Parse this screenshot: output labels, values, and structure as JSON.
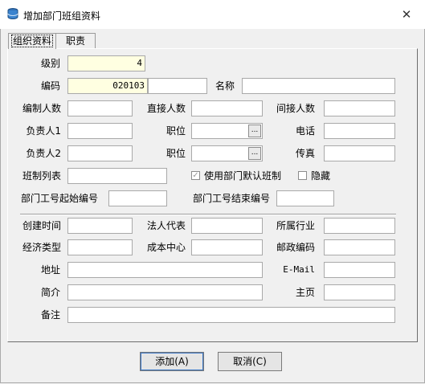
{
  "window": {
    "title": "增加部门班组资料",
    "close_symbol": "✕",
    "app_icon": "database-icon"
  },
  "tabs": [
    {
      "label": "组织资料"
    },
    {
      "label": "职责"
    }
  ],
  "form": {
    "level": {
      "label": "级别",
      "value": "4"
    },
    "code": {
      "label": "编码",
      "value": "020103",
      "extra_value": ""
    },
    "name": {
      "label": "名称",
      "value": ""
    },
    "headcount": {
      "label": "编制人数",
      "value": ""
    },
    "direct_count": {
      "label": "直接人数",
      "value": ""
    },
    "indirect_count": {
      "label": "间接人数",
      "value": ""
    },
    "manager1": {
      "label": "负责人1",
      "value": ""
    },
    "position1": {
      "label": "职位",
      "value": ""
    },
    "phone": {
      "label": "电话",
      "value": ""
    },
    "manager2": {
      "label": "负责人2",
      "value": ""
    },
    "position2": {
      "label": "职位",
      "value": ""
    },
    "fax": {
      "label": "传真",
      "value": ""
    },
    "shift_list": {
      "label": "班制列表",
      "value": ""
    },
    "use_default_shift": {
      "label": "使用部门默认班制",
      "checked": true
    },
    "hidden": {
      "label": "隐藏",
      "checked": false
    },
    "emp_no_start": {
      "label": "部门工号起始编号",
      "value": ""
    },
    "emp_no_end": {
      "label": "部门工号结束编号",
      "value": ""
    },
    "created_time": {
      "label": "创建时间",
      "value": ""
    },
    "legal_rep": {
      "label": "法人代表",
      "value": ""
    },
    "industry": {
      "label": "所属行业",
      "value": ""
    },
    "economic_type": {
      "label": "经济类型",
      "value": ""
    },
    "cost_center": {
      "label": "成本中心",
      "value": ""
    },
    "postal_code": {
      "label": "邮政编码",
      "value": ""
    },
    "address": {
      "label": "地址",
      "value": ""
    },
    "email": {
      "label": "E-Mail",
      "value": ""
    },
    "intro": {
      "label": "简介",
      "value": ""
    },
    "homepage": {
      "label": "主页",
      "value": ""
    },
    "remark": {
      "label": "备注",
      "value": ""
    },
    "ellipsis": "..."
  },
  "buttons": {
    "add": "添加(A)",
    "cancel": "取消(C)"
  }
}
